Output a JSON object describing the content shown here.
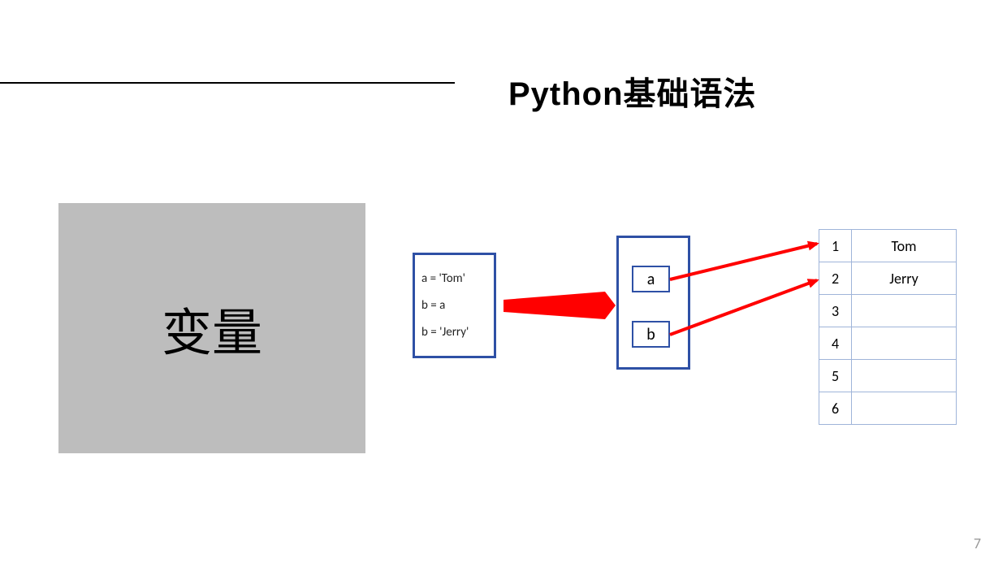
{
  "header": {
    "title": "Python基础语法"
  },
  "sidebar": {
    "label": "变量"
  },
  "code": {
    "line1": "a = 'Tom'",
    "line2": "b = a",
    "line3": "b = 'Jerry'"
  },
  "namespace": {
    "var_a": "a",
    "var_b": "b"
  },
  "memory": {
    "rows": [
      {
        "index": "1",
        "value": "Tom"
      },
      {
        "index": "2",
        "value": "Jerry"
      },
      {
        "index": "3",
        "value": ""
      },
      {
        "index": "4",
        "value": ""
      },
      {
        "index": "5",
        "value": ""
      },
      {
        "index": "6",
        "value": ""
      }
    ]
  },
  "page_number": "7",
  "colors": {
    "box_border": "#2e50a5",
    "arrow": "#ff0000",
    "gray": "#bdbdbd",
    "table_border": "#9fb4d9"
  }
}
